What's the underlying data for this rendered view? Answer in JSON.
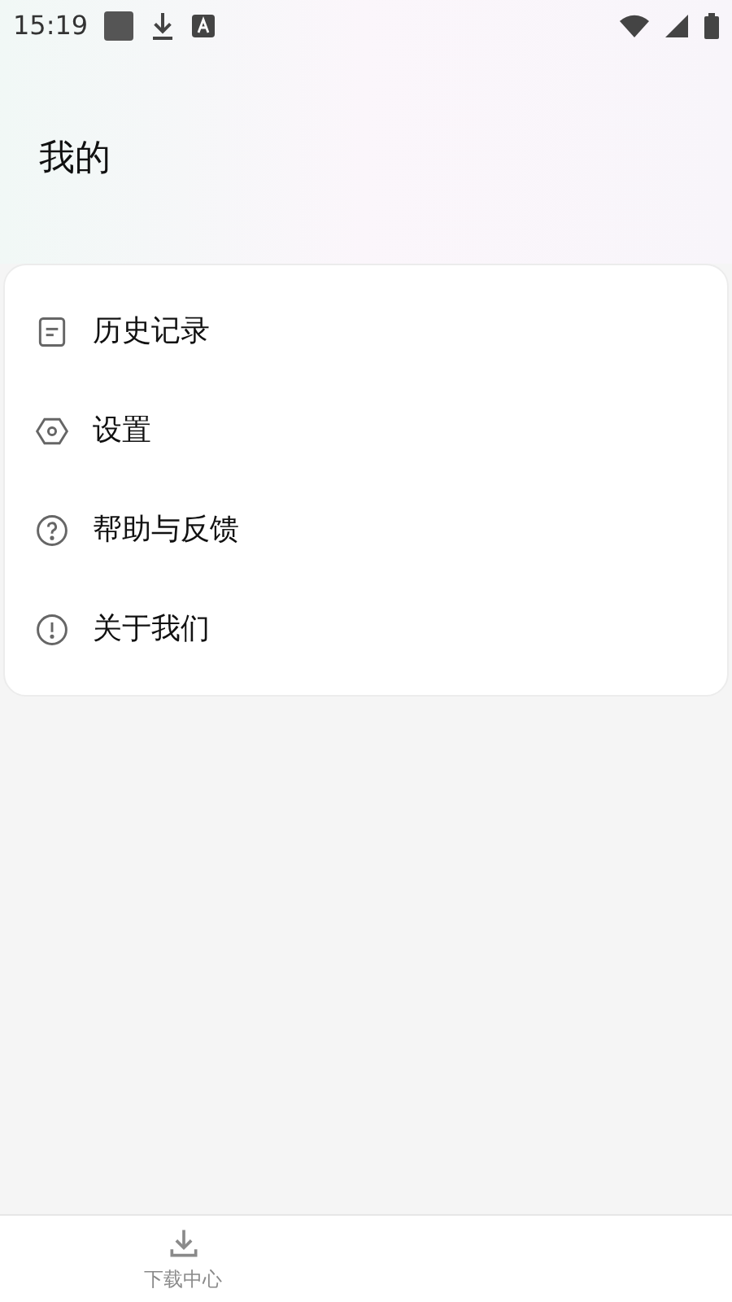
{
  "status_bar": {
    "time": "15:19"
  },
  "header": {
    "title": "我的"
  },
  "menu": [
    {
      "kind": "history",
      "label": "历史记录"
    },
    {
      "kind": "settings",
      "label": "设置"
    },
    {
      "kind": "help",
      "label": "帮助与反馈"
    },
    {
      "kind": "about",
      "label": "关于我们"
    }
  ],
  "bottom_nav": [
    {
      "kind": "download",
      "label": "下载中心"
    }
  ]
}
